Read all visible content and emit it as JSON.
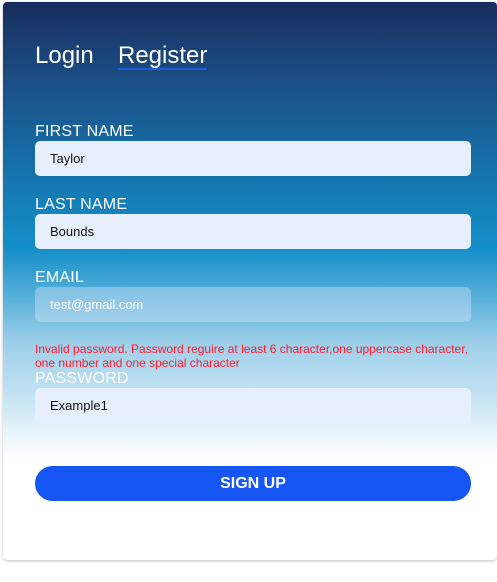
{
  "tabs": {
    "login_label": "Login",
    "register_label": "Register",
    "active": "Register"
  },
  "form": {
    "first_name": {
      "label": "FIRST NAME",
      "value": "Taylor"
    },
    "last_name": {
      "label": "LAST NAME",
      "value": "Bounds"
    },
    "email": {
      "label": "EMAIL",
      "value": "test@gmail.com"
    },
    "password": {
      "label": "PASSWORD",
      "value": "Example1"
    },
    "error_message": "Invalid password. Password reguire at least 6 character,one uppercase character, one number and one special character",
    "submit_label": "SIGN UP"
  },
  "colors": {
    "accent": "#1556f5",
    "tab_underline": "#1f5bd6",
    "error": "#ff1a2e",
    "input_bg": "#e8effc"
  }
}
